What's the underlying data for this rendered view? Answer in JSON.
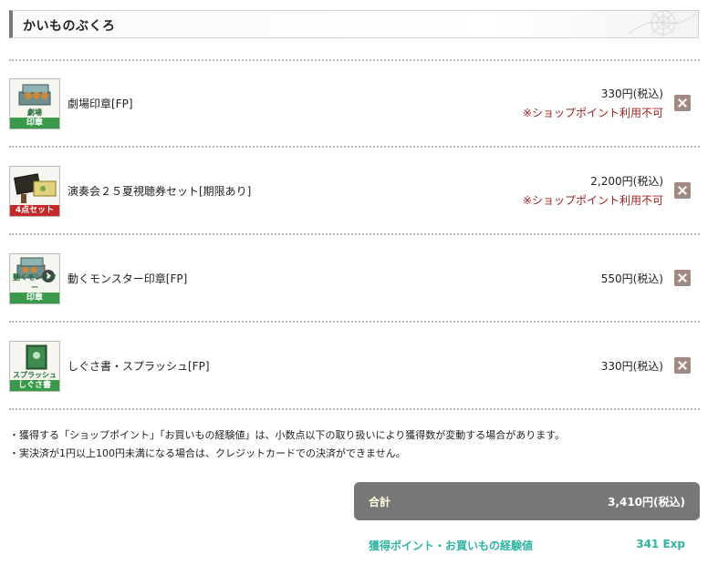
{
  "header": {
    "title": "かいものぶくろ"
  },
  "items": [
    {
      "name": "劇場印章[FP]",
      "price": "330円(税込)",
      "note": "※ショップポイント利用不可",
      "thumb_sub": "劇場",
      "thumb_tag": "印章",
      "tag_color": "#3a9a4a"
    },
    {
      "name": "演奏会２５夏視聴券セット[期限あり]",
      "price": "2,200円(税込)",
      "note": "※ショップポイント利用不可",
      "thumb_tag": "4点セット",
      "tag_color": "#c62828"
    },
    {
      "name": "動くモンスター印章[FP]",
      "price": "550円(税込)",
      "thumb_sub": "動くモンスター",
      "thumb_tag": "印章",
      "tag_color": "#3a9a4a"
    },
    {
      "name": "しぐさ書・スプラッシュ[FP]",
      "price": "330円(税込)",
      "thumb_sub": "スプラッシュ",
      "thumb_tag": "しぐさ書",
      "tag_color": "#3a9a4a"
    }
  ],
  "notes": [
    "・獲得する「ショップポイント」「お買いもの経験値」は、小数点以下の取り扱いにより獲得数が変動する場合があります。",
    "・実決済が1円以上100円未満になる場合は、クレジットカードでの決済ができません。"
  ],
  "total": {
    "label": "合計",
    "value": "3,410円(税込)"
  },
  "earn": {
    "label": "獲得ポイント・お買いもの経験値",
    "value": "341 Exp"
  }
}
